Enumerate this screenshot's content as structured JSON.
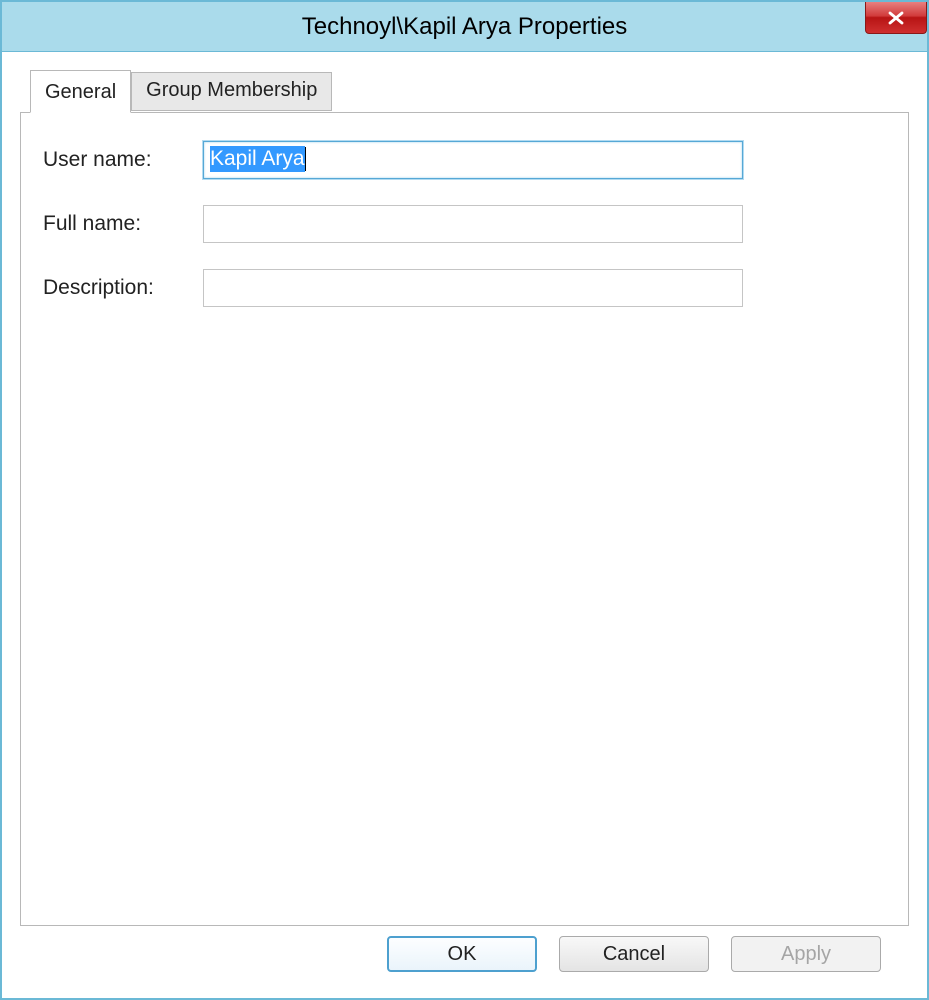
{
  "window": {
    "title": "Technoyl\\Kapil Arya Properties"
  },
  "tabs": [
    {
      "label": "General",
      "active": true
    },
    {
      "label": "Group Membership",
      "active": false
    }
  ],
  "form": {
    "username_label": "User name:",
    "username_value": "Kapil Arya",
    "fullname_label": "Full name:",
    "fullname_value": "",
    "description_label": "Description:",
    "description_value": ""
  },
  "buttons": {
    "ok": "OK",
    "cancel": "Cancel",
    "apply": "Apply"
  }
}
